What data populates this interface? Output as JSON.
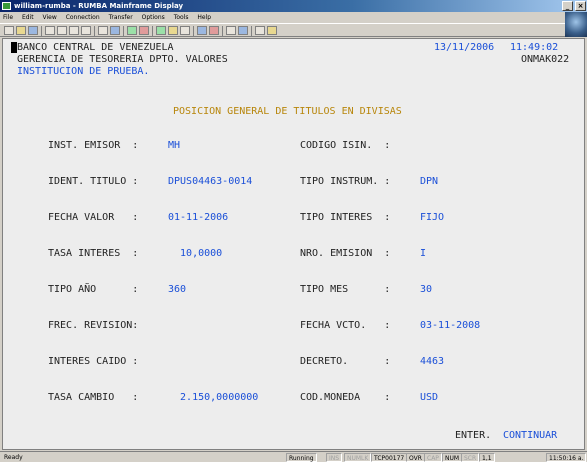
{
  "window": {
    "title": "william-rumba - RUMBA Mainframe Display",
    "min_glyph": "_",
    "close_glyph": "×"
  },
  "menu": [
    "File",
    "Edit",
    "View",
    "Connection",
    "Transfer",
    "Options",
    "Tools",
    "Help"
  ],
  "toolbar": {
    "icons": [
      "new-icon",
      "open-icon",
      "save-icon",
      "print-icon",
      "cut-icon",
      "copy-icon",
      "paste-icon",
      "undo-icon",
      "send-icon",
      "receive-icon",
      "transfer-icon",
      "record-icon",
      "play-icon",
      "macro-icon",
      "color-icon",
      "font-icon",
      "keyboard-icon",
      "display-icon",
      "options-icon",
      "help-icon"
    ]
  },
  "screen": {
    "bank": "BANCO CENTRAL DE VENEZUELA",
    "date": "13/11/2006",
    "time": "11:49:02",
    "department": "GERENCIA DE TESORERIA DPTO. VALORES",
    "screen_id": "ONMAK022",
    "institution": "INSTITUCION DE PRUEBA.",
    "heading": "POSICION GENERAL DE TITULOS EN DIVISAS",
    "left_fields": [
      {
        "label": "INST. EMISOR  :",
        "value": "MH"
      },
      {
        "label": "IDENT. TITULO :",
        "value": "DPUS04463-0014"
      },
      {
        "label": "FECHA VALOR   :",
        "value": "01-11-2006"
      },
      {
        "label": "TASA INTERES  :",
        "value": "  10,0000"
      },
      {
        "label": "TIPO AÑO      :",
        "value": "360"
      },
      {
        "label": "FREC. REVISION:",
        "value": ""
      },
      {
        "label": "INTERES CAIDO :",
        "value": ""
      },
      {
        "label": "TASA CAMBIO   :",
        "value": "  2.150,0000000"
      }
    ],
    "right_fields": [
      {
        "label": "CODIGO ISIN.  :",
        "value": ""
      },
      {
        "label": "TIPO INSTRUM. :",
        "value": "DPN"
      },
      {
        "label": "TIPO INTERES  :",
        "value": "FIJO"
      },
      {
        "label": "NRO. EMISION  :",
        "value": "I"
      },
      {
        "label": "TIPO MES      :",
        "value": "30"
      },
      {
        "label": "FECHA VCTO.   :",
        "value": "03-11-2008"
      },
      {
        "label": "DECRETO.      :",
        "value": "4463"
      },
      {
        "label": "COD.MONEDA    :",
        "value": "USD"
      }
    ],
    "footer_key": "ENTER.",
    "footer_action": "CONTINUAR"
  },
  "status": {
    "ready": "Ready",
    "running": "Running",
    "ins": "INS",
    "numlk": "NUMLK",
    "session": "TCP00177",
    "ovr": "OVR",
    "cap": "CAP",
    "num": "NUM",
    "scrl": "SCR",
    "cursor": "1,1",
    "clock": "11:50:16 a."
  },
  "colors": {
    "field_value": "#1a4fd8",
    "screen_bg": "#ededed"
  }
}
